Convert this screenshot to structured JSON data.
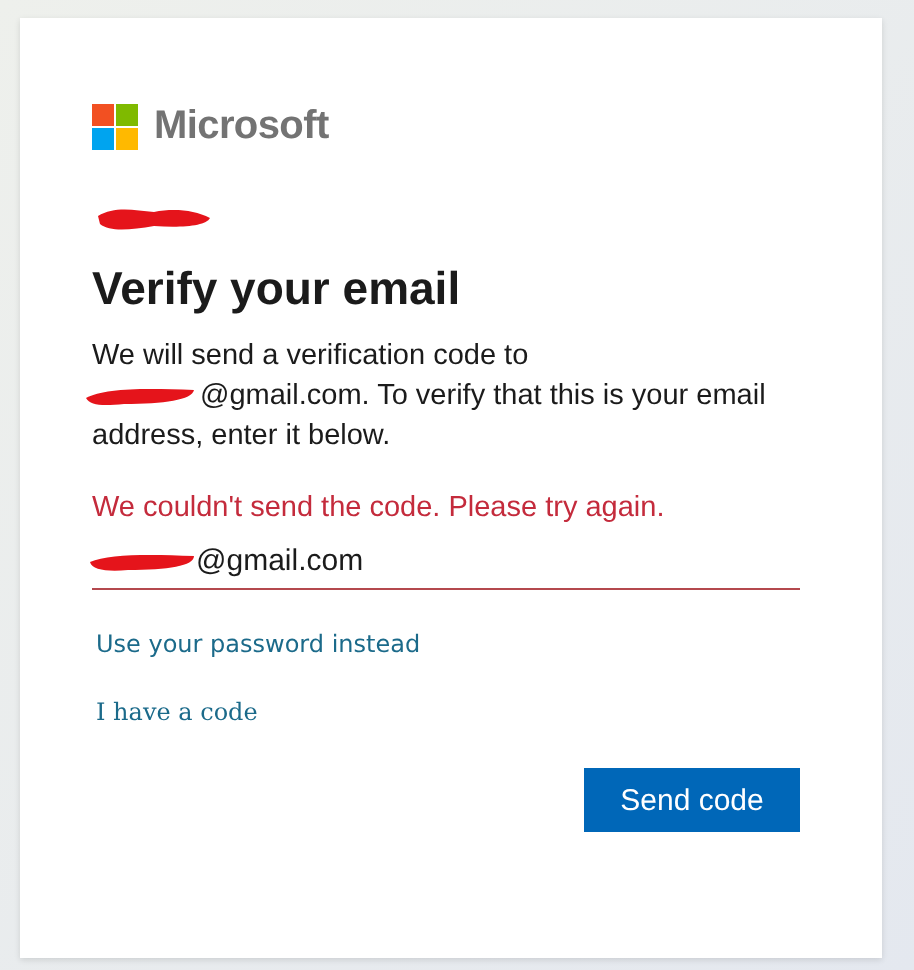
{
  "brand": "Microsoft",
  "heading": "Verify your email",
  "message_lines": [
    "We will send a verification code to",
    "@gmail.com. To verify that this is your email",
    "address, enter it below."
  ],
  "error": "We couldn't send the code. Please try again.",
  "email_field": {
    "value": "@gmail.com",
    "invalid": true
  },
  "links": [
    "Use your password instead",
    "I have a code"
  ],
  "button": "Send code"
}
